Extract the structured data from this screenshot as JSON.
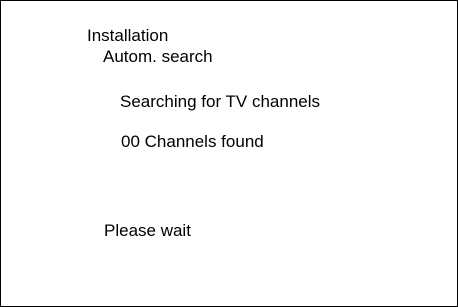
{
  "menu": {
    "title": "Installation",
    "submenu": "Autom. search"
  },
  "search": {
    "status": "Searching for TV channels",
    "result": "00 Channels found",
    "channels_found": 0,
    "prompt": "Please wait"
  },
  "colors": {
    "background": "#ffffff",
    "text": "#000000",
    "border": "#000000"
  }
}
